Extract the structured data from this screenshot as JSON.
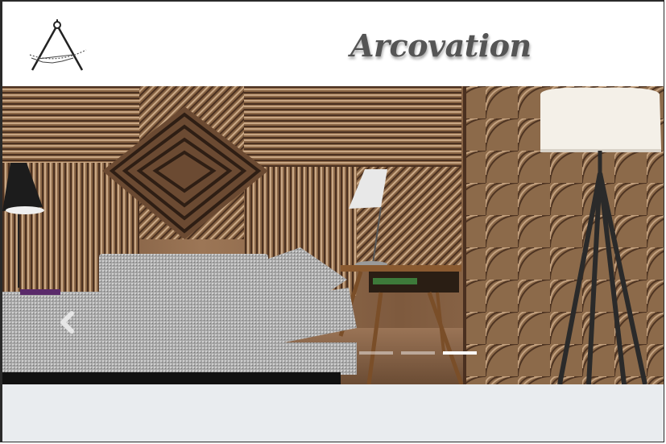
{
  "header": {
    "brand_name": "Arcovation",
    "logo_icon": "drafting-compass-icon"
  },
  "carousel": {
    "prev_icon": "chevron-left-icon",
    "slide_count": 3,
    "active_index": 2
  },
  "colors": {
    "brand_text": "#555555",
    "below_band": "#e9ecef"
  }
}
